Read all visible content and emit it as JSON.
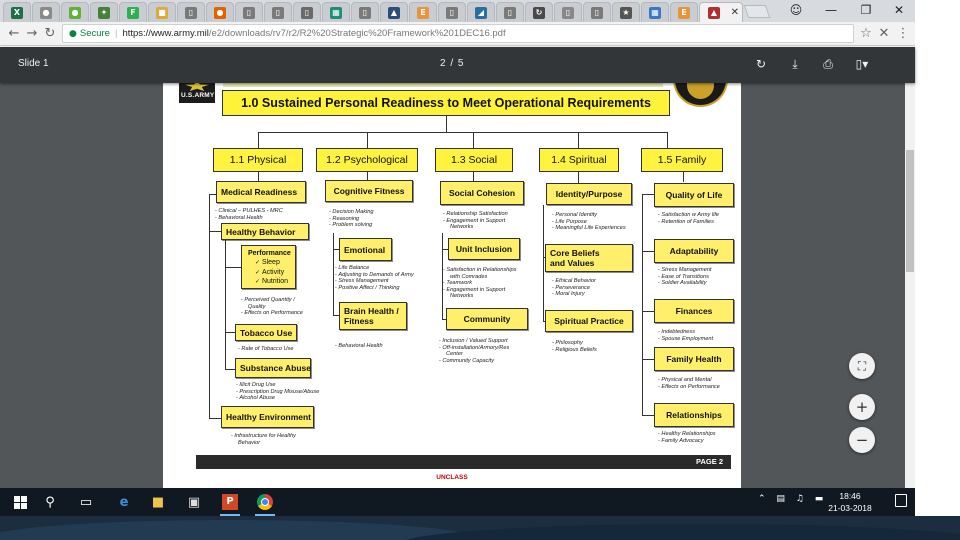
{
  "browser": {
    "tabs": [
      {
        "icon": "excel-icon",
        "glyph": "X",
        "color": "#1d7044"
      },
      {
        "icon": "globe-icon",
        "glyph": "●",
        "color": "#8a8a8a"
      },
      {
        "icon": "evernote-icon",
        "glyph": "●",
        "color": "#5fb336"
      },
      {
        "icon": "extension-icon",
        "glyph": "✦",
        "color": "#4a7f3a"
      },
      {
        "icon": "feedly-icon",
        "glyph": "F",
        "color": "#2bb24c"
      },
      {
        "icon": "folder-icon",
        "glyph": "■",
        "color": "#e0a83c"
      },
      {
        "icon": "document-icon",
        "glyph": "▯",
        "color": "#7a7a7a"
      },
      {
        "icon": "firefox-icon",
        "glyph": "●",
        "color": "#e66000"
      },
      {
        "icon": "document-icon",
        "glyph": "▯",
        "color": "#7a7a7a"
      },
      {
        "icon": "document-icon",
        "glyph": "▯",
        "color": "#7a7a7a"
      },
      {
        "icon": "pdf-icon",
        "glyph": "▯",
        "color": "#6a6a6a"
      },
      {
        "icon": "sheets-icon",
        "glyph": "▦",
        "color": "#1e8e78"
      },
      {
        "icon": "document-icon",
        "glyph": "▯",
        "color": "#7a7a7a"
      },
      {
        "icon": "education-icon",
        "glyph": "▲",
        "color": "#2c4d7a"
      },
      {
        "icon": "edge-book-icon",
        "glyph": "E",
        "color": "#e8943a"
      },
      {
        "icon": "document-icon",
        "glyph": "▯",
        "color": "#7a7a7a"
      },
      {
        "icon": "chart-icon",
        "glyph": "◢",
        "color": "#2a6f9e"
      },
      {
        "icon": "document-icon",
        "glyph": "▯",
        "color": "#7a7a7a"
      },
      {
        "icon": "refresh-site-icon",
        "glyph": "↻",
        "color": "#4a4a4a"
      },
      {
        "icon": "mail-icon",
        "glyph": "▯",
        "color": "#888888"
      },
      {
        "icon": "document-icon",
        "glyph": "▯",
        "color": "#7a7a7a"
      },
      {
        "icon": "star-icon",
        "glyph": "★",
        "color": "#555555"
      },
      {
        "icon": "grid-icon",
        "glyph": "▦",
        "color": "#3b78c2"
      },
      {
        "icon": "edge-book-icon",
        "glyph": "E",
        "color": "#e8943a"
      },
      {
        "icon": "army-site-icon",
        "glyph": "▲",
        "color": "#b03030",
        "active": true
      }
    ],
    "secure_label": "Secure",
    "url_host": "https://www.army.mil",
    "url_path": "/e2/downloads/rv7/r2/R2%20Strategic%20Framework%201DEC16.pdf"
  },
  "pdf_viewer": {
    "title": "Slide 1",
    "page_current": "2",
    "page_separator": "/",
    "page_total": "5"
  },
  "document": {
    "logo_text": "U.S.ARMY",
    "main_title": "1.0 Sustained Personal Readiness to Meet Operational Requirements",
    "categories": [
      "1.1 Physical",
      "1.2 Psychological",
      "1.3 Social",
      "1.4 Spiritual",
      "1.5 Family"
    ],
    "physical": {
      "medical_readiness": "Medical Readiness",
      "medical_notes": [
        "Clinical – PULHES - MRC",
        "Behavioral Health"
      ],
      "healthy_behavior": "Healthy  Behavior",
      "performance_title": "Performance",
      "performance_items": [
        "Sleep",
        "Activity",
        "Nutrition"
      ],
      "performance_notes": [
        "Perceived Quantity /",
        "Quality",
        "Effects on Performance"
      ],
      "tobacco_use": "Tobacco Use",
      "tobacco_notes": [
        "Rate of Tobacco Use"
      ],
      "substance_abuse": "Substance Abuse",
      "substance_notes": [
        "Illicit Drug Use",
        "Prescription Drug Misuse/Abuse",
        "Alcohol Abuse"
      ],
      "healthy_environment": "Healthy Environment",
      "environment_notes": [
        "Infrastructure for Healthy",
        "Behavior"
      ]
    },
    "psychological": {
      "cognitive_fitness": "Cognitive Fitness",
      "cognitive_notes": [
        "Decision Making",
        "Reasoning",
        "Problem solving"
      ],
      "emotional": "Emotional",
      "emotional_notes": [
        "Life Balance",
        "Adjusting to Demands of Army",
        "Stress Management",
        "Positive Affect / Thinking"
      ],
      "brain_health_l1": "Brain Health /",
      "brain_health_l2": "Fitness",
      "brain_notes": [
        "Behavioral Health"
      ]
    },
    "social": {
      "social_cohesion": "Social Cohesion",
      "cohesion_notes": [
        "Relationship Satisfaction",
        "Engagement in Support",
        "Networks"
      ],
      "unit_inclusion": "Unit Inclusion",
      "inclusion_notes": [
        "Satisfaction in Relationships",
        "with Comrades",
        "Teamwork",
        "Engagement in Support",
        "Networks"
      ],
      "community": "Community",
      "community_notes": [
        "Inclusion / Valued Support",
        "Off-installation/Armory/Res",
        "Center",
        "Community Capacity"
      ]
    },
    "spiritual": {
      "identity_purpose": "Identity/Purpose",
      "identity_notes": [
        "Personal Identity",
        "Life Purpose",
        "Meaningful Life Experiences"
      ],
      "core_beliefs_l1": "Core Beliefs",
      "core_beliefs_l2": "and Values",
      "core_notes": [
        "Ethical Behavior",
        "Perseverance",
        "Moral Injury"
      ],
      "spiritual_practice": "Spiritual Practice",
      "practice_notes": [
        "Philosophy",
        "Religious Beliefs"
      ]
    },
    "family": {
      "quality_of_life": "Quality of Life",
      "quality_notes": [
        "Satisfaction w Army life",
        "Retention of Families"
      ],
      "adaptability": "Adaptability",
      "adapt_notes": [
        "Stress Management",
        "Ease of Transitions",
        "Soldier Availability"
      ],
      "finances": "Finances",
      "finance_notes": [
        "Indebtedness",
        "Spouse Employment"
      ],
      "family_health": "Family Health",
      "health_notes": [
        "Physical and Mental",
        "Effects on Performance"
      ],
      "relationships": "Relationships",
      "relationship_notes": [
        "Healthy Relationships",
        "Family Advocacy"
      ]
    },
    "footer_page": "PAGE 2",
    "classification": "UNCLASS"
  },
  "taskbar": {
    "clock_time": "18:46",
    "clock_date": "21-03-2018",
    "apps": [
      "windows-start-icon",
      "search-icon",
      "task-view-icon",
      "edge-icon",
      "file-explorer-icon",
      "store-icon",
      "powerpoint-icon",
      "chrome-icon"
    ]
  },
  "colors": {
    "box_yellow": "#fff340",
    "pdf_toolbar": "#323639",
    "pdf_background": "#525659",
    "taskbar": "#101922",
    "classification_red": "#c00000"
  }
}
